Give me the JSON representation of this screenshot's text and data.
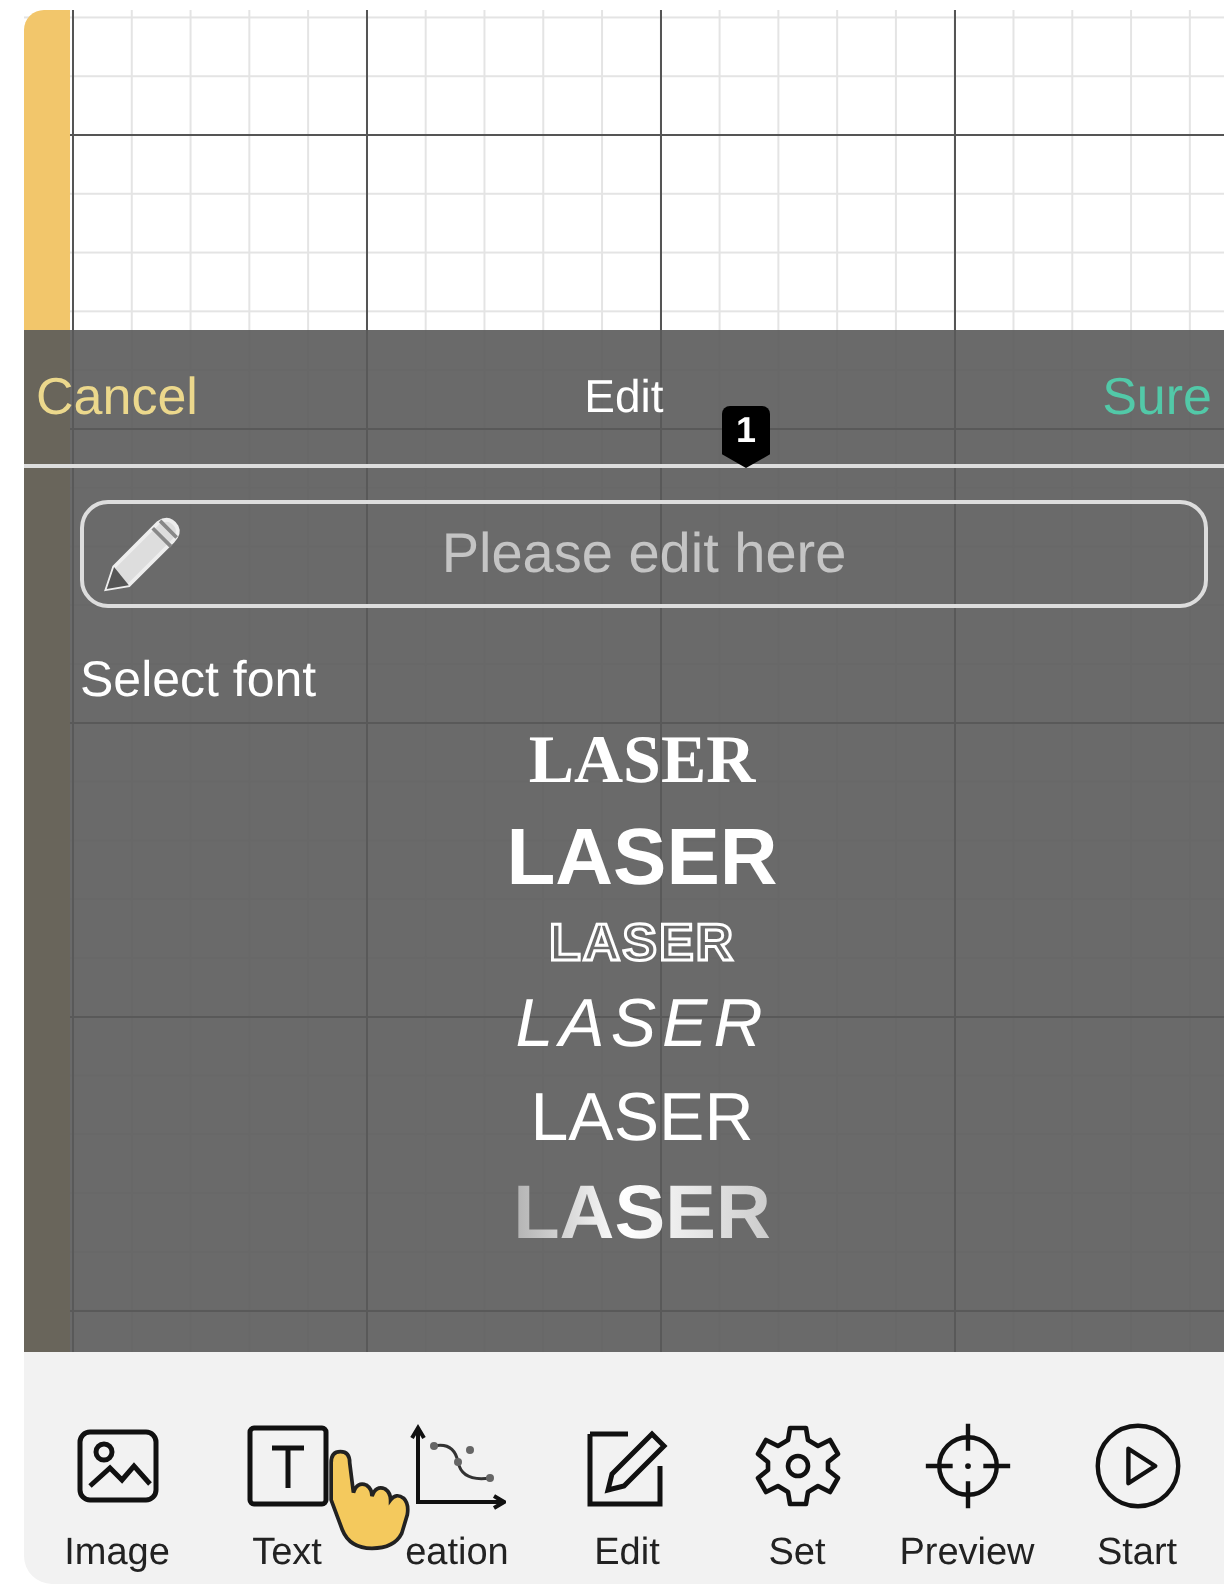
{
  "edit_dialog": {
    "cancel": "Cancel",
    "title": "Edit",
    "confirm": "Sure",
    "marker": "1",
    "text_field": {
      "placeholder": "Please edit here"
    },
    "font_heading": "Select font",
    "fonts": [
      {
        "kind": "serif",
        "sample": "LASER"
      },
      {
        "kind": "bold",
        "sample": "LASER"
      },
      {
        "kind": "outline",
        "sample": "LASER"
      },
      {
        "kind": "sketch",
        "sample": "LASER"
      },
      {
        "kind": "sans",
        "sample": "LASER"
      },
      {
        "kind": "shaded",
        "sample": "LASER"
      }
    ]
  },
  "toolbar": [
    {
      "kind": "image",
      "label": "Image"
    },
    {
      "kind": "text",
      "label": "Text"
    },
    {
      "kind": "curve",
      "label": "eation"
    },
    {
      "kind": "edit",
      "label": "Edit"
    },
    {
      "kind": "gear",
      "label": "Set"
    },
    {
      "kind": "crosshair",
      "label": "Preview"
    },
    {
      "kind": "play",
      "label": "Start"
    }
  ]
}
